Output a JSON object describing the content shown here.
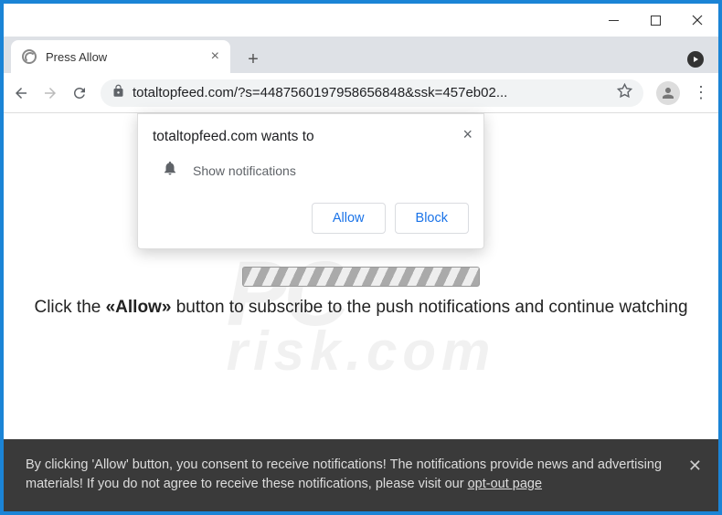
{
  "window": {
    "tab_title": "Press Allow",
    "url": "totaltopfeed.com/?s=4487560197958656848&ssk=457eb02..."
  },
  "permission": {
    "prompt": "totaltopfeed.com wants to",
    "item": "Show notifications",
    "allow": "Allow",
    "block": "Block"
  },
  "page": {
    "instruction_pre": "Click the ",
    "instruction_bold": "«Allow»",
    "instruction_post": " button to subscribe to the push notifications and continue watching"
  },
  "cookie": {
    "text": "By clicking 'Allow' button, you consent to receive notifications! The notifications provide news and advertising materials! If you do not agree to receive these notifications, please visit our ",
    "link": "opt-out page"
  },
  "watermark": {
    "line1": "PC",
    "line2": "risk.com"
  }
}
